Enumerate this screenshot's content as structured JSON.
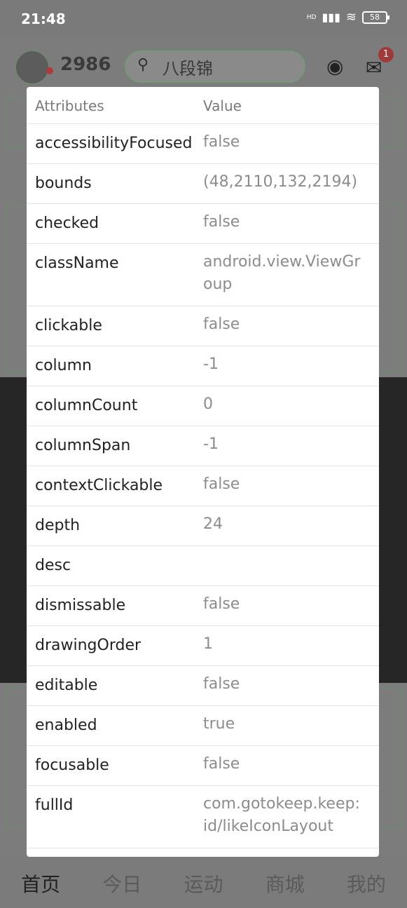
{
  "status_bar": {
    "time": "21:48",
    "battery": "58",
    "network_label": "HD"
  },
  "background_app": {
    "points": "2986",
    "search_placeholder": "八段锦",
    "mail_badge": "1",
    "tabs": [
      "首页",
      "今日",
      "运动",
      "商城",
      "我的"
    ]
  },
  "dialog": {
    "header": {
      "key": "Attributes",
      "value": "Value"
    },
    "rows": [
      {
        "key": "accessibilityFocused",
        "value": "false"
      },
      {
        "key": "bounds",
        "value": "(48,2110,132,2194)"
      },
      {
        "key": "checked",
        "value": "false"
      },
      {
        "key": "className",
        "value": "android.view.ViewGroup"
      },
      {
        "key": "clickable",
        "value": "false"
      },
      {
        "key": "column",
        "value": "-1"
      },
      {
        "key": "columnCount",
        "value": "0"
      },
      {
        "key": "columnSpan",
        "value": "-1"
      },
      {
        "key": "contextClickable",
        "value": "false"
      },
      {
        "key": "depth",
        "value": "24"
      },
      {
        "key": "desc",
        "value": ""
      },
      {
        "key": "dismissable",
        "value": "false"
      },
      {
        "key": "drawingOrder",
        "value": "1"
      },
      {
        "key": "editable",
        "value": "false"
      },
      {
        "key": "enabled",
        "value": "true"
      },
      {
        "key": "focusable",
        "value": "false"
      },
      {
        "key": "fullId",
        "value": "com.gotokeep.keep:id/likeIconLayout"
      }
    ]
  }
}
